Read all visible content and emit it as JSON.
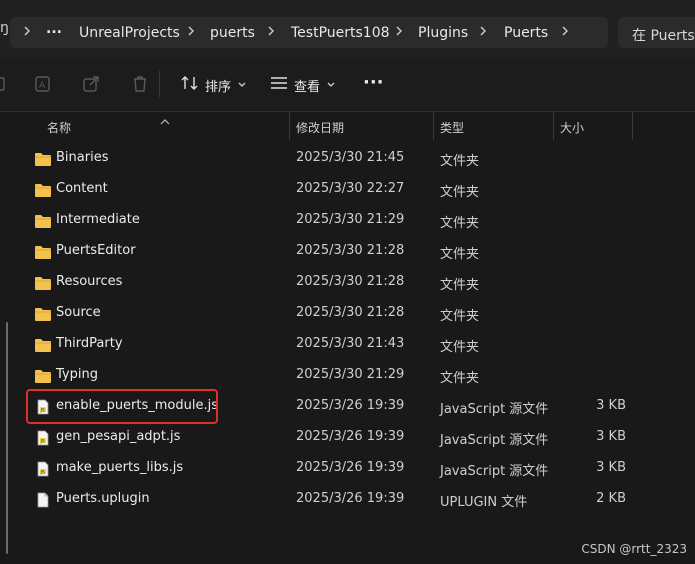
{
  "breadcrumb": {
    "partial_left": "ŋ",
    "items": [
      "...",
      "UnrealProjects",
      "puerts",
      "TestPuerts108",
      "Plugins",
      "Puerts"
    ],
    "search_placeholder": "在 Puerts 中"
  },
  "toolbar": {
    "sort_label": "排序",
    "view_label": "查看",
    "more_label": "···"
  },
  "columns": {
    "name": "名称",
    "modified": "修改日期",
    "type": "类型",
    "size": "大小"
  },
  "files": [
    {
      "name": "Binaries",
      "date": "2025/3/30 21:45",
      "type": "文件夹",
      "size": "",
      "kind": "folder"
    },
    {
      "name": "Content",
      "date": "2025/3/30 22:27",
      "type": "文件夹",
      "size": "",
      "kind": "folder"
    },
    {
      "name": "Intermediate",
      "date": "2025/3/30 21:29",
      "type": "文件夹",
      "size": "",
      "kind": "folder"
    },
    {
      "name": "PuertsEditor",
      "date": "2025/3/30 21:28",
      "type": "文件夹",
      "size": "",
      "kind": "folder"
    },
    {
      "name": "Resources",
      "date": "2025/3/30 21:28",
      "type": "文件夹",
      "size": "",
      "kind": "folder"
    },
    {
      "name": "Source",
      "date": "2025/3/30 21:28",
      "type": "文件夹",
      "size": "",
      "kind": "folder"
    },
    {
      "name": "ThirdParty",
      "date": "2025/3/30 21:43",
      "type": "文件夹",
      "size": "",
      "kind": "folder"
    },
    {
      "name": "Typing",
      "date": "2025/3/30 21:29",
      "type": "文件夹",
      "size": "",
      "kind": "folder"
    },
    {
      "name": "enable_puerts_module.js",
      "date": "2025/3/26 19:39",
      "type": "JavaScript 源文件",
      "size": "3 KB",
      "kind": "js"
    },
    {
      "name": "gen_pesapi_adpt.js",
      "date": "2025/3/26 19:39",
      "type": "JavaScript 源文件",
      "size": "3 KB",
      "kind": "js"
    },
    {
      "name": "make_puerts_libs.js",
      "date": "2025/3/26 19:39",
      "type": "JavaScript 源文件",
      "size": "3 KB",
      "kind": "js"
    },
    {
      "name": "Puerts.uplugin",
      "date": "2025/3/26 19:39",
      "type": "UPLUGIN 文件",
      "size": "2 KB",
      "kind": "file"
    }
  ],
  "watermark": "CSDN @rrtt_2323",
  "colors": {
    "background": "#191919",
    "folder": "#f2c14e",
    "highlight": "#e0302a"
  }
}
